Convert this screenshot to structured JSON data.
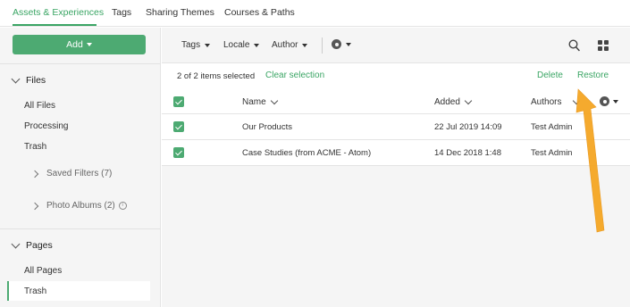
{
  "topnav": {
    "tabs": [
      "Assets & Experiences",
      "Tags",
      "Sharing Themes",
      "Courses & Paths"
    ]
  },
  "sidebar": {
    "add_label": "Add",
    "files_heading": "Files",
    "file_items": [
      "All Files",
      "Processing",
      "Trash"
    ],
    "saved_filters": "Saved Filters (7)",
    "photo_albums": "Photo Albums (2)",
    "info_glyph": "i",
    "pages_heading": "Pages",
    "page_items": [
      "All Pages",
      "Trash"
    ]
  },
  "toolbar": {
    "filters": [
      "Tags",
      "Locale",
      "Author"
    ],
    "icons": [
      "gear-icon",
      "search-icon",
      "grid-view-icon"
    ]
  },
  "selection": {
    "count_text": "2 of 2 items selected",
    "clear_label": "Clear selection",
    "delete_label": "Delete",
    "restore_label": "Restore"
  },
  "table": {
    "columns": [
      "Name",
      "Added",
      "Authors"
    ],
    "rows": [
      {
        "name": "Our Products",
        "added": "22 Jul 2019 14:09",
        "author": "Test Admin"
      },
      {
        "name": "Case Studies (from ACME - Atom)",
        "added": "14 Dec 2018 1:48",
        "author": "Test Admin"
      }
    ]
  },
  "colors": {
    "accent": "#3aa564",
    "button": "#4daa72",
    "annotation_arrow": "#f5a623"
  }
}
